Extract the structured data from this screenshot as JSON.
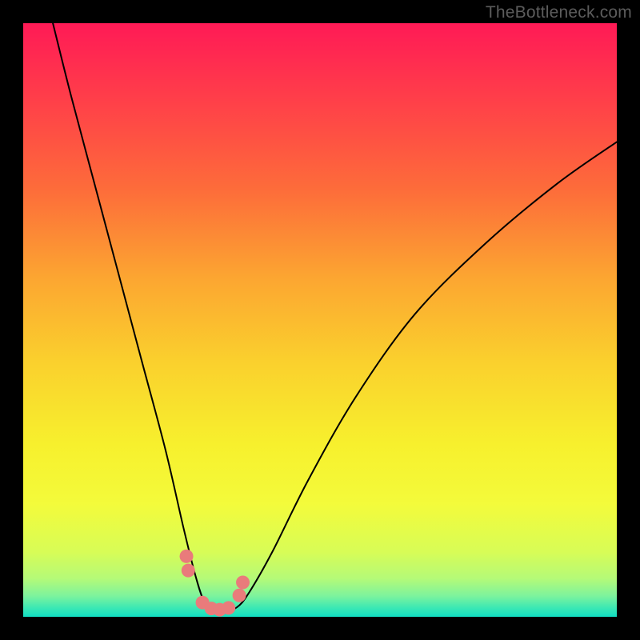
{
  "watermark": "TheBottleneck.com",
  "chart_data": {
    "type": "line",
    "title": "",
    "xlabel": "",
    "ylabel": "",
    "xlim": [
      0,
      100
    ],
    "ylim": [
      0,
      100
    ],
    "series": [
      {
        "name": "bottleneck-curve",
        "x": [
          5,
          8,
          12,
          16,
          20,
          24,
          27,
          29,
          30.5,
          32,
          34,
          36,
          38,
          42,
          48,
          56,
          66,
          78,
          90,
          100
        ],
        "y": [
          100,
          88,
          73,
          58,
          43,
          28,
          15,
          7,
          2.5,
          1.2,
          1.0,
          1.6,
          4,
          11,
          23,
          37,
          51,
          63,
          73,
          80
        ]
      }
    ],
    "marker_cluster": {
      "name": "highlight-dots",
      "x": [
        27.5,
        27.8,
        30.2,
        31.7,
        33.1,
        34.6,
        36.4,
        37.0
      ],
      "y": [
        10.2,
        7.8,
        2.4,
        1.4,
        1.2,
        1.5,
        3.6,
        5.8
      ]
    },
    "gradient_stops": [
      {
        "offset": 0.0,
        "color": "#ff1a56"
      },
      {
        "offset": 0.13,
        "color": "#ff3f49"
      },
      {
        "offset": 0.28,
        "color": "#fd6c3a"
      },
      {
        "offset": 0.43,
        "color": "#fca631"
      },
      {
        "offset": 0.57,
        "color": "#fad02d"
      },
      {
        "offset": 0.71,
        "color": "#f7f02d"
      },
      {
        "offset": 0.81,
        "color": "#f3fb3b"
      },
      {
        "offset": 0.89,
        "color": "#d8fc56"
      },
      {
        "offset": 0.935,
        "color": "#b5fa77"
      },
      {
        "offset": 0.965,
        "color": "#7df39d"
      },
      {
        "offset": 0.985,
        "color": "#3be8b4"
      },
      {
        "offset": 1.0,
        "color": "#11dec2"
      }
    ]
  }
}
